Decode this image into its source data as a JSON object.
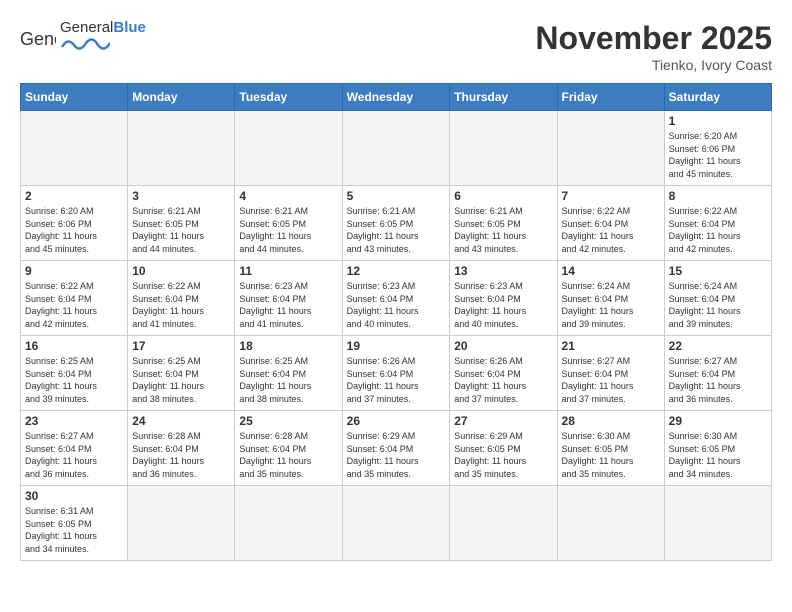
{
  "header": {
    "logo_general": "General",
    "logo_blue": "Blue",
    "month": "November 2025",
    "location": "Tienko, Ivory Coast"
  },
  "days_of_week": [
    "Sunday",
    "Monday",
    "Tuesday",
    "Wednesday",
    "Thursday",
    "Friday",
    "Saturday"
  ],
  "weeks": [
    [
      {
        "day": "",
        "info": ""
      },
      {
        "day": "",
        "info": ""
      },
      {
        "day": "",
        "info": ""
      },
      {
        "day": "",
        "info": ""
      },
      {
        "day": "",
        "info": ""
      },
      {
        "day": "",
        "info": ""
      },
      {
        "day": "1",
        "info": "Sunrise: 6:20 AM\nSunset: 6:06 PM\nDaylight: 11 hours\nand 45 minutes."
      }
    ],
    [
      {
        "day": "2",
        "info": "Sunrise: 6:20 AM\nSunset: 6:06 PM\nDaylight: 11 hours\nand 45 minutes."
      },
      {
        "day": "3",
        "info": "Sunrise: 6:21 AM\nSunset: 6:05 PM\nDaylight: 11 hours\nand 44 minutes."
      },
      {
        "day": "4",
        "info": "Sunrise: 6:21 AM\nSunset: 6:05 PM\nDaylight: 11 hours\nand 44 minutes."
      },
      {
        "day": "5",
        "info": "Sunrise: 6:21 AM\nSunset: 6:05 PM\nDaylight: 11 hours\nand 43 minutes."
      },
      {
        "day": "6",
        "info": "Sunrise: 6:21 AM\nSunset: 6:05 PM\nDaylight: 11 hours\nand 43 minutes."
      },
      {
        "day": "7",
        "info": "Sunrise: 6:22 AM\nSunset: 6:04 PM\nDaylight: 11 hours\nand 42 minutes."
      },
      {
        "day": "8",
        "info": "Sunrise: 6:22 AM\nSunset: 6:04 PM\nDaylight: 11 hours\nand 42 minutes."
      }
    ],
    [
      {
        "day": "9",
        "info": "Sunrise: 6:22 AM\nSunset: 6:04 PM\nDaylight: 11 hours\nand 42 minutes."
      },
      {
        "day": "10",
        "info": "Sunrise: 6:22 AM\nSunset: 6:04 PM\nDaylight: 11 hours\nand 41 minutes."
      },
      {
        "day": "11",
        "info": "Sunrise: 6:23 AM\nSunset: 6:04 PM\nDaylight: 11 hours\nand 41 minutes."
      },
      {
        "day": "12",
        "info": "Sunrise: 6:23 AM\nSunset: 6:04 PM\nDaylight: 11 hours\nand 40 minutes."
      },
      {
        "day": "13",
        "info": "Sunrise: 6:23 AM\nSunset: 6:04 PM\nDaylight: 11 hours\nand 40 minutes."
      },
      {
        "day": "14",
        "info": "Sunrise: 6:24 AM\nSunset: 6:04 PM\nDaylight: 11 hours\nand 39 minutes."
      },
      {
        "day": "15",
        "info": "Sunrise: 6:24 AM\nSunset: 6:04 PM\nDaylight: 11 hours\nand 39 minutes."
      }
    ],
    [
      {
        "day": "16",
        "info": "Sunrise: 6:25 AM\nSunset: 6:04 PM\nDaylight: 11 hours\nand 39 minutes."
      },
      {
        "day": "17",
        "info": "Sunrise: 6:25 AM\nSunset: 6:04 PM\nDaylight: 11 hours\nand 38 minutes."
      },
      {
        "day": "18",
        "info": "Sunrise: 6:25 AM\nSunset: 6:04 PM\nDaylight: 11 hours\nand 38 minutes."
      },
      {
        "day": "19",
        "info": "Sunrise: 6:26 AM\nSunset: 6:04 PM\nDaylight: 11 hours\nand 37 minutes."
      },
      {
        "day": "20",
        "info": "Sunrise: 6:26 AM\nSunset: 6:04 PM\nDaylight: 11 hours\nand 37 minutes."
      },
      {
        "day": "21",
        "info": "Sunrise: 6:27 AM\nSunset: 6:04 PM\nDaylight: 11 hours\nand 37 minutes."
      },
      {
        "day": "22",
        "info": "Sunrise: 6:27 AM\nSunset: 6:04 PM\nDaylight: 11 hours\nand 36 minutes."
      }
    ],
    [
      {
        "day": "23",
        "info": "Sunrise: 6:27 AM\nSunset: 6:04 PM\nDaylight: 11 hours\nand 36 minutes."
      },
      {
        "day": "24",
        "info": "Sunrise: 6:28 AM\nSunset: 6:04 PM\nDaylight: 11 hours\nand 36 minutes."
      },
      {
        "day": "25",
        "info": "Sunrise: 6:28 AM\nSunset: 6:04 PM\nDaylight: 11 hours\nand 35 minutes."
      },
      {
        "day": "26",
        "info": "Sunrise: 6:29 AM\nSunset: 6:04 PM\nDaylight: 11 hours\nand 35 minutes."
      },
      {
        "day": "27",
        "info": "Sunrise: 6:29 AM\nSunset: 6:05 PM\nDaylight: 11 hours\nand 35 minutes."
      },
      {
        "day": "28",
        "info": "Sunrise: 6:30 AM\nSunset: 6:05 PM\nDaylight: 11 hours\nand 35 minutes."
      },
      {
        "day": "29",
        "info": "Sunrise: 6:30 AM\nSunset: 6:05 PM\nDaylight: 11 hours\nand 34 minutes."
      }
    ],
    [
      {
        "day": "30",
        "info": "Sunrise: 6:31 AM\nSunset: 6:05 PM\nDaylight: 11 hours\nand 34 minutes."
      },
      {
        "day": "",
        "info": ""
      },
      {
        "day": "",
        "info": ""
      },
      {
        "day": "",
        "info": ""
      },
      {
        "day": "",
        "info": ""
      },
      {
        "day": "",
        "info": ""
      },
      {
        "day": "",
        "info": ""
      }
    ]
  ]
}
